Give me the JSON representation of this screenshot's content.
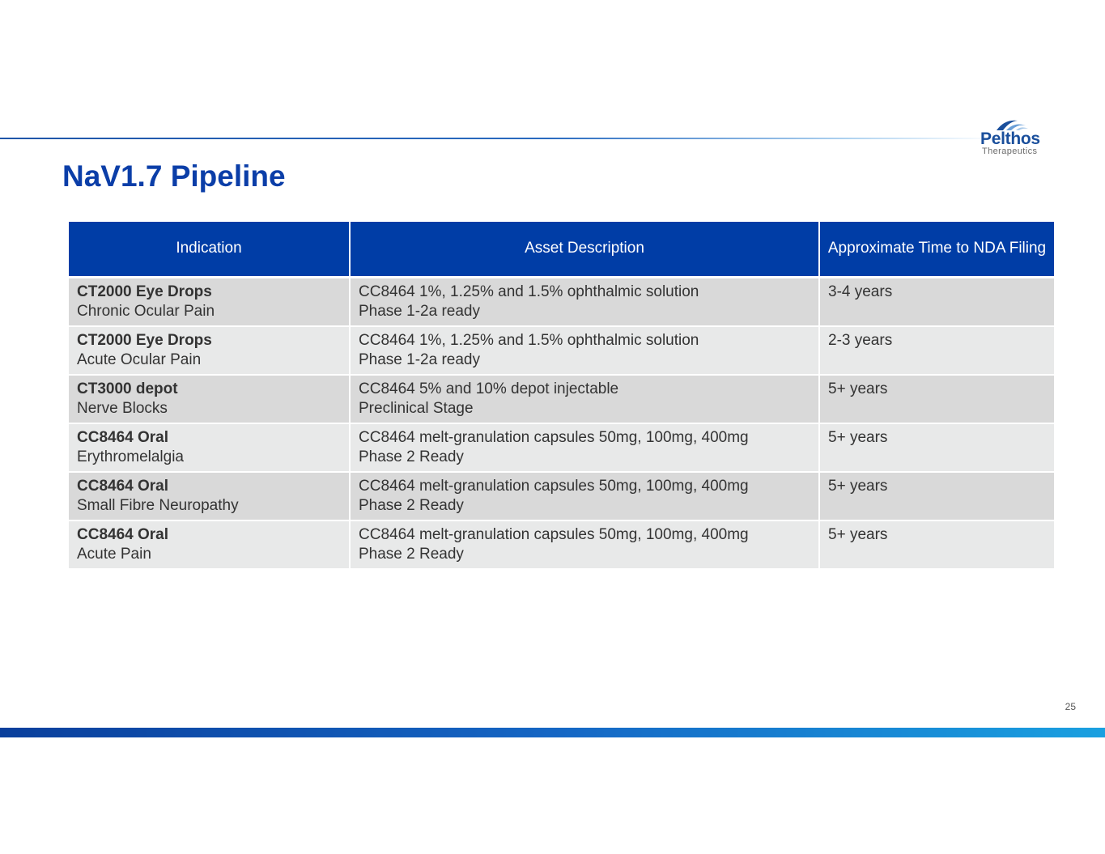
{
  "header": {
    "title": "NaV1.7 Pipeline"
  },
  "logo": {
    "name": "Pelthos",
    "sub": "Therapeutics",
    "icon": "arc-logo-icon"
  },
  "colors": {
    "brand_blue": "#003da6",
    "title_blue": "#0b3ea8",
    "row_dark": "#d9d9d9",
    "row_light": "#e8e9e9"
  },
  "table": {
    "headers": [
      "Indication",
      "Asset Description",
      "Approximate Time to NDA Filing"
    ],
    "rows": [
      {
        "name": "CT2000 Eye Drops",
        "indication": "Chronic Ocular Pain",
        "asset": [
          "CC8464 1%, 1.25% and 1.5% ophthalmic solution",
          "Phase 1-2a ready"
        ],
        "time": "3-4 years"
      },
      {
        "name": "CT2000 Eye Drops",
        "indication": "Acute Ocular Pain",
        "asset": [
          "CC8464 1%, 1.25% and 1.5% ophthalmic solution",
          "Phase 1-2a ready"
        ],
        "time": "2-3 years"
      },
      {
        "name": "CT3000 depot",
        "indication": "Nerve Blocks",
        "asset": [
          "CC8464 5% and 10% depot injectable",
          "Preclinical Stage"
        ],
        "time": "5+ years"
      },
      {
        "name": "CC8464 Oral",
        "indication": "Erythromelalgia",
        "asset": [
          "CC8464 melt-granulation capsules 50mg, 100mg, 400mg",
          "Phase 2 Ready"
        ],
        "time": "5+ years"
      },
      {
        "name": "CC8464 Oral",
        "indication": "Small Fibre Neuropathy",
        "asset": [
          "CC8464 melt-granulation capsules 50mg, 100mg, 400mg",
          "Phase 2 Ready"
        ],
        "time": "5+ years"
      },
      {
        "name": "CC8464 Oral",
        "indication": "Acute Pain",
        "asset": [
          "CC8464 melt-granulation capsules 50mg, 100mg, 400mg",
          "Phase 2 Ready"
        ],
        "time": "5+ years"
      }
    ]
  },
  "footer": {
    "page_number": "25"
  }
}
